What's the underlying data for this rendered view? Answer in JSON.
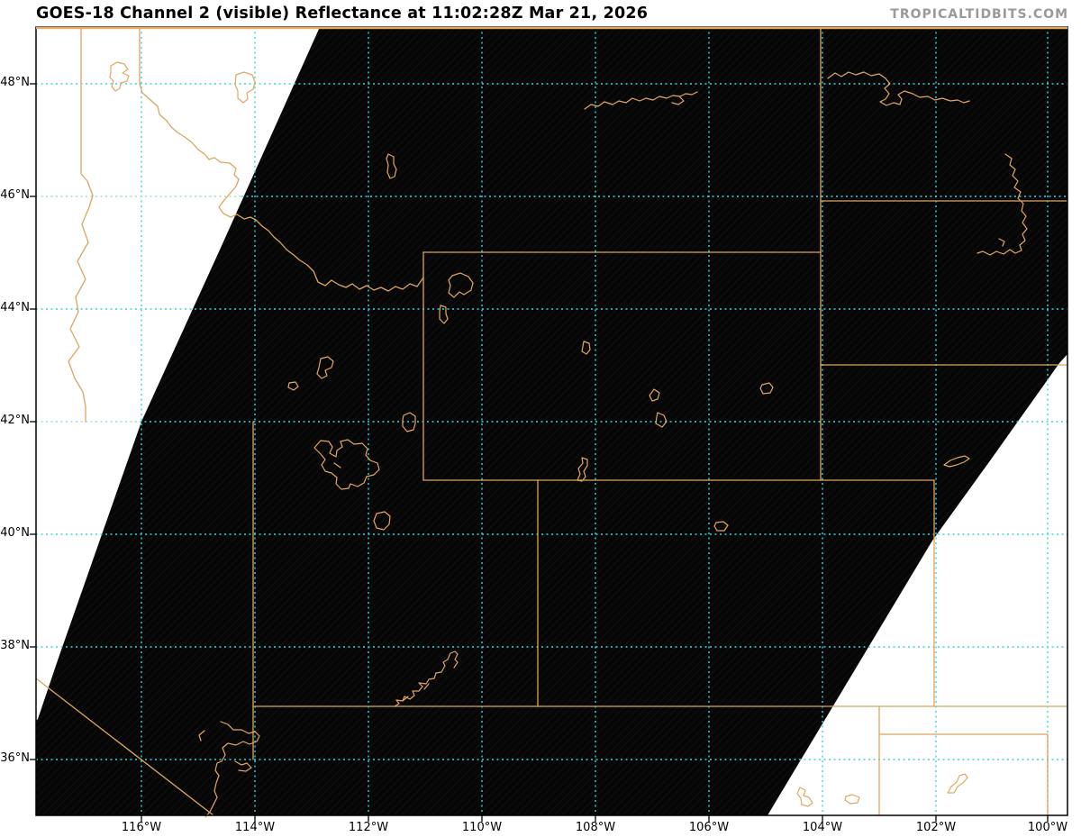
{
  "header": {
    "title": "GOES-18 Channel 2 (visible) Reflectance at 11:02:28Z Mar 21, 2026",
    "watermark": "TROPICALTIDBITS.COM"
  },
  "axes": {
    "x_labels": [
      "116°W",
      "114°W",
      "112°W",
      "110°W",
      "108°W",
      "106°W",
      "104°W",
      "102°W",
      "100°W"
    ],
    "y_labels": [
      "48°N",
      "46°N",
      "44°N",
      "42°N",
      "40°N",
      "38°N",
      "36°N"
    ]
  },
  "map": {
    "layers": {
      "satellite_night_fill": "black scan swath (no visible reflectance at night)",
      "no_data_fill": "white (outside scan sector)",
      "graticule": "dotted lat/lon lines every 2 degrees",
      "overlays": "state borders and lake outlines in tan"
    }
  },
  "colors": {
    "state_border": "#dba55f",
    "lake_outline": "#e2a763",
    "top_border_line": "#e2aa66",
    "gridline_cyan": "#38d7dc",
    "gridline_green": "#98e8b0",
    "night_fill": "#060606",
    "no_data_fill": "#ffffff",
    "axis_frame": "#000000",
    "title_color": "#000000",
    "watermark_color": "#9a9a9a"
  }
}
